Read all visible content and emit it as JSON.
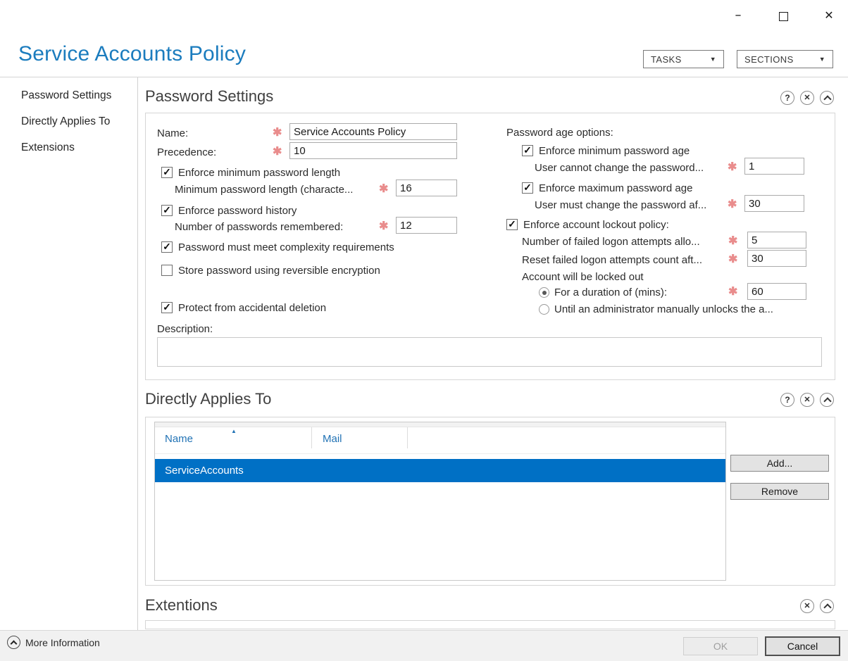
{
  "icons": {
    "minimize": "–",
    "close": "✕",
    "help": "?",
    "dropdown": "▼",
    "sort_ascending": "▲",
    "required": "✱",
    "check": "✓"
  },
  "colors": {
    "title_blue": "#1b7cbe",
    "selection_blue": "#0070c5",
    "link_blue": "#2273b5",
    "required_red": "#e98c8c"
  },
  "header": {
    "title": "Service Accounts Policy",
    "tasks_button": "TASKS",
    "sections_button": "SECTIONS"
  },
  "sidebar": {
    "items": [
      {
        "label": "Password Settings"
      },
      {
        "label": "Directly Applies To"
      },
      {
        "label": "Extensions"
      }
    ]
  },
  "password_settings": {
    "title": "Password Settings",
    "name_label": "Name:",
    "name_value": "Service Accounts Policy",
    "precedence_label": "Precedence:",
    "precedence_value": "10",
    "enforce_min_length_label": "Enforce minimum password length",
    "min_length_label": "Minimum password length (characte...",
    "min_length_value": "16",
    "enforce_history_label": "Enforce password history",
    "history_label": "Number of passwords remembered:",
    "history_value": "12",
    "complexity_label": "Password must meet complexity requirements",
    "reversible_label": "Store password using reversible encryption",
    "protect_label": "Protect from accidental deletion",
    "description_label": "Description:",
    "description_value": "",
    "age_options_label": "Password age options:",
    "enforce_min_age_label": "Enforce minimum password age",
    "min_age_label": "User cannot change the password...",
    "min_age_value": "1",
    "enforce_max_age_label": "Enforce maximum password age",
    "max_age_label": "User must change the password af...",
    "max_age_value": "30",
    "lockout_label": "Enforce account lockout policy:",
    "failed_attempts_label": "Number of failed logon attempts allo...",
    "failed_attempts_value": "5",
    "reset_count_label": "Reset failed logon attempts count aft...",
    "reset_count_value": "30",
    "locked_out_label": "Account will be locked out",
    "duration_label": "For a duration of (mins):",
    "duration_value": "60",
    "until_admin_label": "Until an administrator manually unlocks the a..."
  },
  "directly_applies_to": {
    "title": "Directly Applies To",
    "columns": [
      "Name",
      "Mail"
    ],
    "rows": [
      {
        "name": "ServiceAccounts",
        "mail": ""
      }
    ],
    "add_button": "Add...",
    "remove_button": "Remove"
  },
  "extensions_section": {
    "title": "Extentions"
  },
  "footer": {
    "more_information": "More Information",
    "ok_button": "OK",
    "cancel_button": "Cancel"
  }
}
